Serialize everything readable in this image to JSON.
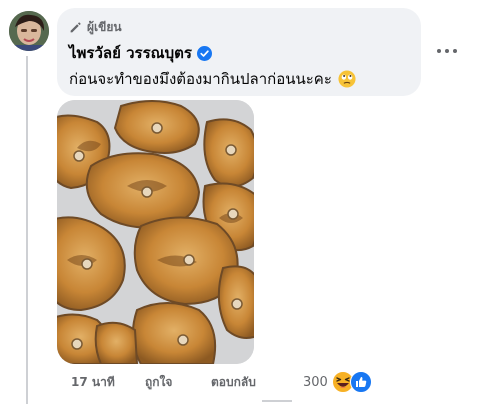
{
  "comment": {
    "author_badge": "ผู้เขียน",
    "author_name": "ไพรวัลย์ วรรณบุตร",
    "text": "ก่อนจะทำของมึงต้องมากินปลาก่อนนะคะ",
    "text_emoji": "rolling-eyes-emoji",
    "time": "17 นาที",
    "like_label": "ถูกใจ",
    "reply_label": "ตอบกลับ",
    "reaction_count": "300",
    "reaction_icons": [
      "haha-reaction-icon",
      "like-reaction-icon"
    ]
  },
  "colors": {
    "bubble_bg": "#f0f2f5",
    "verified_blue": "#1877f2",
    "secondary_text": "#65676b",
    "haha_yellow": "#f7b125"
  }
}
